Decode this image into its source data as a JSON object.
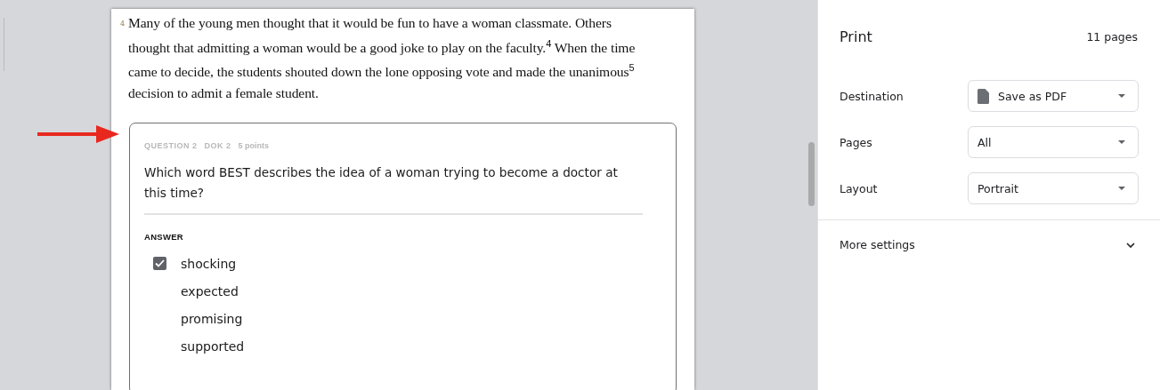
{
  "document": {
    "line_number": "4",
    "paragraph": "Many of the young men thought that it would be fun to have a woman classmate. Others thought that admitting a woman would be a good joke to play on the faculty.$^{4}$ When the time came to decide, the students shouted down the lone opposing vote and made the unanimous$^{5}$ decision to admit a female student.",
    "question": {
      "meta": [
        "QUESTION 2",
        "DOK 2"
      ],
      "points": "5 points",
      "prompt": "Which word BEST describes the idea of a woman trying to become a doctor at this time?",
      "answer_label": "ANSWER",
      "choices": [
        {
          "label": "shocking",
          "checked": true
        },
        {
          "label": "expected",
          "checked": false
        },
        {
          "label": "promising",
          "checked": false
        },
        {
          "label": "supported",
          "checked": false
        }
      ]
    }
  },
  "print_panel": {
    "title": "Print",
    "page_count": "11 pages",
    "settings": [
      {
        "label": "Destination",
        "value": "Save as PDF",
        "kind": "file"
      },
      {
        "label": "Pages",
        "value": "All",
        "kind": "plain"
      },
      {
        "label": "Layout",
        "value": "Portrait",
        "kind": "plain"
      }
    ],
    "more_settings": {
      "label": "More settings",
      "expanded": false
    }
  }
}
